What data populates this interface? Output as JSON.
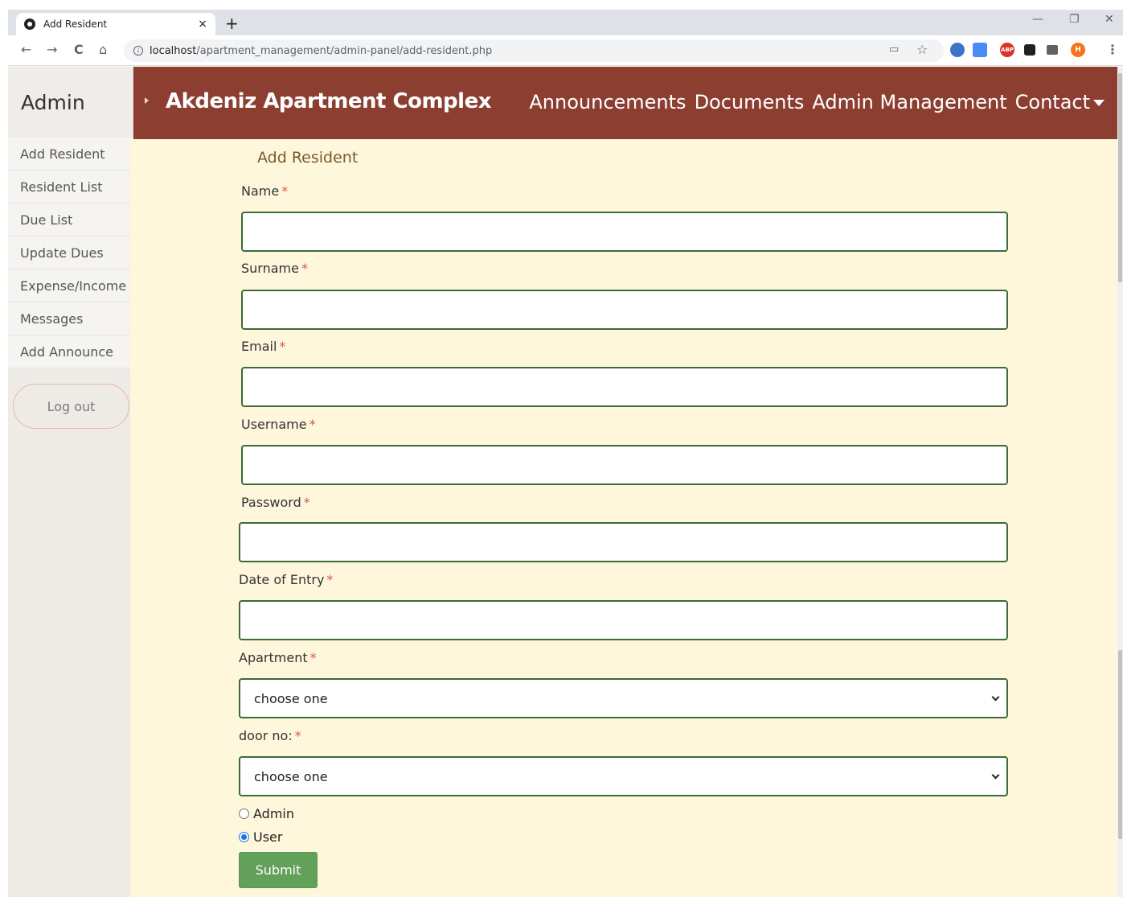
{
  "browser": {
    "tab_title": "Add Resident",
    "tab_close": "×",
    "new_tab": "+",
    "back": "←",
    "forward": "→",
    "reload": "C",
    "home": "⌂",
    "url_host": "localhost",
    "url_path": "/apartment_management/admin-panel/add-resident.php",
    "star": "☆",
    "cast": "▭",
    "minimize": "—",
    "restore": "❐",
    "close": "✕",
    "profile_initial": "H",
    "abp_label": "ABP",
    "menu": "⋮"
  },
  "sidebar": {
    "brand": "Admin",
    "items": [
      {
        "label": "Add Resident"
      },
      {
        "label": "Resident List"
      },
      {
        "label": "Due List"
      },
      {
        "label": "Update Dues"
      },
      {
        "label": "Expense/Income"
      },
      {
        "label": "Messages"
      },
      {
        "label": "Add Announce"
      }
    ],
    "logout": "Log out"
  },
  "topbar": {
    "site_title": "Akdeniz Apartment Complex",
    "nav": [
      "Announcements",
      "Documents",
      "Admin Management",
      "Contact"
    ]
  },
  "form": {
    "title": "Add Resident",
    "required_mark": "*",
    "labels": {
      "name": "Name",
      "surname": "Surname",
      "email": "Email",
      "username": "Username",
      "password": "Password",
      "date_of_entry": "Date of Entry",
      "apartment": "Apartment",
      "door_no": "door no:"
    },
    "apartment_selected": "choose one",
    "door_selected": "choose one",
    "role_options": [
      "Admin",
      "User"
    ],
    "role_selected": "User",
    "submit": "Submit"
  },
  "colors": {
    "topbar": "#8c3f31",
    "content_bg": "#fff7db",
    "input_border": "#3b6b36",
    "submit_bg": "#63a05a"
  }
}
